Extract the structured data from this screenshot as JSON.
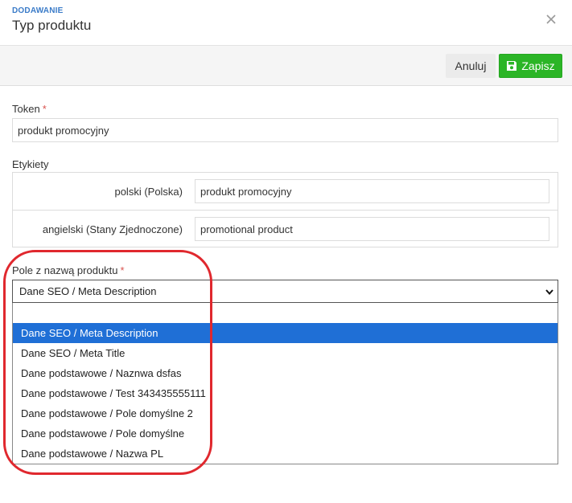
{
  "dialog": {
    "subtitle": "DODAWANIE",
    "title": "Typ produktu"
  },
  "toolbar": {
    "cancel_label": "Anuluj",
    "save_label": "Zapisz"
  },
  "token": {
    "label": "Token",
    "required_mark": "*",
    "value": "produkt promocyjny"
  },
  "labels": {
    "section_label": "Etykiety",
    "rows": [
      {
        "language": "polski (Polska)",
        "value": "produkt promocyjny"
      },
      {
        "language": "angielski (Stany Zjednoczone)",
        "value": "promotional product"
      }
    ]
  },
  "name_field": {
    "label": "Pole z nazwą produktu",
    "required_mark": "*",
    "selected": "Dane SEO / Meta Description",
    "options": [
      "Dane SEO / Meta Description",
      "Dane SEO / Meta Title",
      "Dane podstawowe / Naznwa dsfas",
      "Dane podstawowe / Test 343435555111",
      "Dane podstawowe / Pole domyślne 2",
      "Dane podstawowe / Pole domyślne",
      "Dane podstawowe / Nazwa PL"
    ]
  },
  "icons": {
    "close": "close-icon",
    "save": "floppy-disk-icon",
    "chevron": "chevron-down-icon"
  },
  "colors": {
    "accent": "#3a7bc8",
    "save_button": "#2bb526",
    "selected_option": "#1f6fd6",
    "required": "#d9534f",
    "annotation": "#e0282e"
  }
}
